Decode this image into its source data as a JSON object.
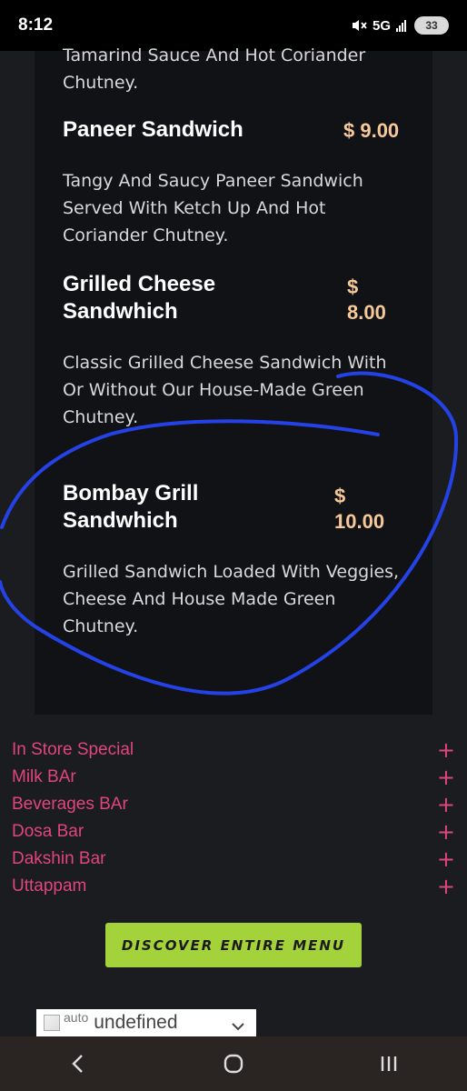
{
  "status_bar": {
    "time": "8:12",
    "network": "5G",
    "battery": "33"
  },
  "menu_items": [
    {
      "description": "Tamarind Sauce And Hot Coriander Chutney."
    },
    {
      "name": "Paneer Sandwich",
      "price": "$ 9.00",
      "description": "Tangy And Saucy Paneer Sandwich Served With Ketch Up And Hot Coriander Chutney."
    },
    {
      "name_line1": "Grilled Cheese",
      "name_line2": "Sandwhich",
      "price_line1": "$",
      "price_line2": "8.00",
      "description": "Classic Grilled Cheese Sandwich With Or Without Our House-Made Green Chutney."
    },
    {
      "name_line1": "Bombay Grill",
      "name_line2": "Sandwhich",
      "price_line1": "$",
      "price_line2": "10.00",
      "description": "Grilled Sandwich Loaded With Veggies, Cheese And House Made Green Chutney."
    }
  ],
  "categories": [
    {
      "label": "In Store Special"
    },
    {
      "label": "Milk BAr"
    },
    {
      "label": "Beverages BAr"
    },
    {
      "label": "Dosa Bar"
    },
    {
      "label": "Dakshin Bar"
    },
    {
      "label": "Uttappam"
    }
  ],
  "cta": {
    "label": "Discover Entire Menu"
  },
  "language_widget": {
    "alt_text": "auto",
    "value": "undefined"
  },
  "colors": {
    "accent_pink": "#e0467a",
    "price": "#f7c999",
    "cta_green": "#a4d23a",
    "annotation_blue": "#2442e6"
  },
  "icons": {
    "plus": "+",
    "nav": [
      "back-icon",
      "home-icon",
      "recents-icon"
    ]
  }
}
